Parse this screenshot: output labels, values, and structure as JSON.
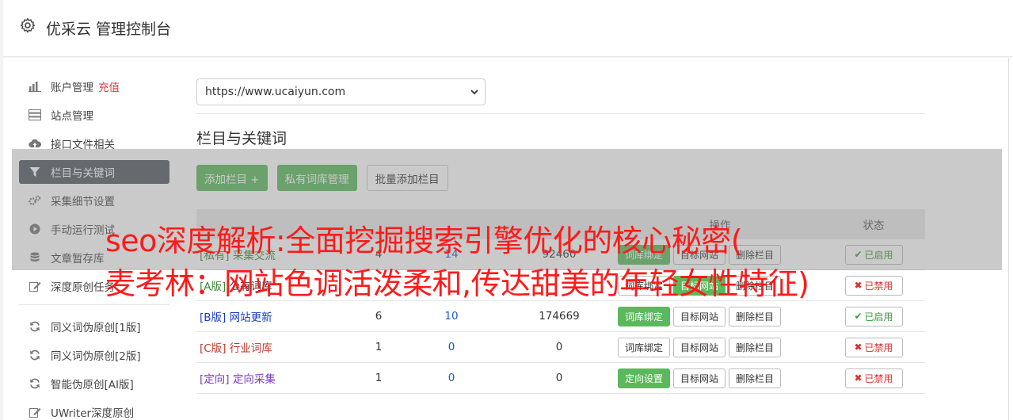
{
  "header": {
    "title": "优采云 管理控制台",
    "icon": "gear-icon"
  },
  "sidebar": {
    "items": [
      {
        "label": "账户管理",
        "extra": "充值",
        "icon": "bar-chart-icon"
      },
      {
        "label": "站点管理",
        "icon": "server-icon"
      },
      {
        "label": "接口文件相关",
        "icon": "cloud-upload-icon"
      },
      {
        "label": "栏目与关键词",
        "icon": "filter-icon",
        "active": true
      },
      {
        "label": "采集细节设置",
        "icon": "gears-icon"
      },
      {
        "label": "手动运行测试",
        "icon": "play-circle-icon"
      },
      {
        "label": "文章暂存库",
        "icon": "database-icon"
      },
      {
        "label": "深度原创任务",
        "icon": "edit-icon"
      }
    ],
    "items2": [
      {
        "label": "同义词伪原创[1版]",
        "icon": "refresh-icon"
      },
      {
        "label": "同义词伪原创[2版]",
        "icon": "refresh-icon"
      },
      {
        "label": "智能伪原创[AI版]",
        "icon": "refresh-icon"
      },
      {
        "label": "UWriter深度原创",
        "icon": "edit-icon"
      }
    ]
  },
  "site_select": {
    "value": "https://www.ucaiyun.com"
  },
  "section": {
    "title": "栏目与关键词"
  },
  "toolbar": {
    "add": "添加栏目 +",
    "private_lib": "私有词库管理",
    "batch_add": "批量添加栏目"
  },
  "table": {
    "headers": {
      "ops": "操作",
      "status": "状态"
    },
    "rows": [
      {
        "tag": "[私有]",
        "name": "采集交流",
        "n1": "4",
        "n2": "14",
        "n3": "92460",
        "op1": "词库绑定",
        "op2": "目标网站",
        "op3": "删除栏目",
        "status": "已启用",
        "on": true
      },
      {
        "tag": "[A版]",
        "name": "公有词库",
        "n1": "",
        "n2": "",
        "n3": "",
        "op1": "词库绑定",
        "op2": "目标网站",
        "op3": "删除栏目",
        "status": "已禁用",
        "on": false
      },
      {
        "tag": "[B版]",
        "name": "网站更新",
        "n1": "6",
        "n2": "10",
        "n3": "174669",
        "op1": "词库绑定",
        "op2": "目标网站",
        "op3": "删除栏目",
        "status": "已启用",
        "on": true
      },
      {
        "tag": "[C版]",
        "name": "行业词库",
        "n1": "1",
        "n2": "0",
        "n3": "0",
        "op1": "词库绑定",
        "op2": "目标网站",
        "op3": "删除栏目",
        "status": "已禁用",
        "on": false
      },
      {
        "tag": "[定向]",
        "name": "定向采集",
        "n1": "1",
        "n2": "0",
        "n3": "0",
        "op1": "定向设置",
        "op2": "目标网站",
        "op3": "删除栏目",
        "status": "已禁用",
        "on": false
      }
    ]
  },
  "overlay": {
    "line1": "seo深度解析:全面挖掘搜索引擎优化的核心秘密(",
    "line2": "麦考林：网站色调活泼柔和,传达甜美的年轻女性特征)"
  },
  "colors": {
    "green": "#5cb85c",
    "active_nav": "#545b62",
    "overlay_text": "#ff1a1a",
    "charge": "#e4393c"
  }
}
